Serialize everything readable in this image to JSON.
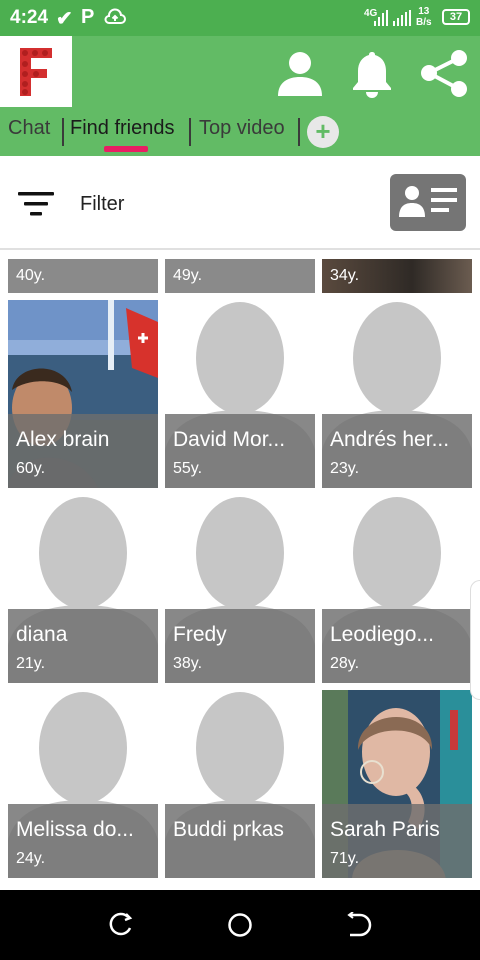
{
  "status_bar": {
    "time": "4:24",
    "check_icon": "check-icon",
    "p_icon": "P",
    "cloud_icon": "cloud-upload-icon",
    "network": "4G",
    "speed_top": "13",
    "speed_bottom": "B/s",
    "battery": "37"
  },
  "header": {
    "logo_letter": "F",
    "logo_color": "#d32f2f",
    "icons": [
      "profile-icon",
      "bell-icon",
      "share-icon"
    ]
  },
  "tabs": [
    {
      "label": "Chat",
      "active": false
    },
    {
      "label": "Find friends",
      "active": true
    },
    {
      "label": "Top video",
      "active": false
    }
  ],
  "accent_color": "#e91e63",
  "brand_color": "#62bb65",
  "filter": {
    "label": "Filter"
  },
  "users_partial": [
    {
      "age": "40y."
    },
    {
      "age": "49y."
    },
    {
      "age": "34y."
    }
  ],
  "users": [
    {
      "name": "Alex brain",
      "age": "60y.",
      "photo": "photo"
    },
    {
      "name": "David Mor...",
      "age": "55y.",
      "photo": "placeholder"
    },
    {
      "name": "Andrés her...",
      "age": "23y.",
      "photo": "placeholder"
    },
    {
      "name": "diana",
      "age": "21y.",
      "photo": "placeholder"
    },
    {
      "name": "Fredy",
      "age": "38y.",
      "photo": "placeholder"
    },
    {
      "name": "Leodiego...",
      "age": "28y.",
      "photo": "placeholder"
    },
    {
      "name": "Melissa do...",
      "age": "24y.",
      "photo": "placeholder"
    },
    {
      "name": "Buddi prkas",
      "age": "",
      "photo": "placeholder"
    },
    {
      "name": "Sarah Paris",
      "age": "71y.",
      "photo": "photo"
    }
  ]
}
